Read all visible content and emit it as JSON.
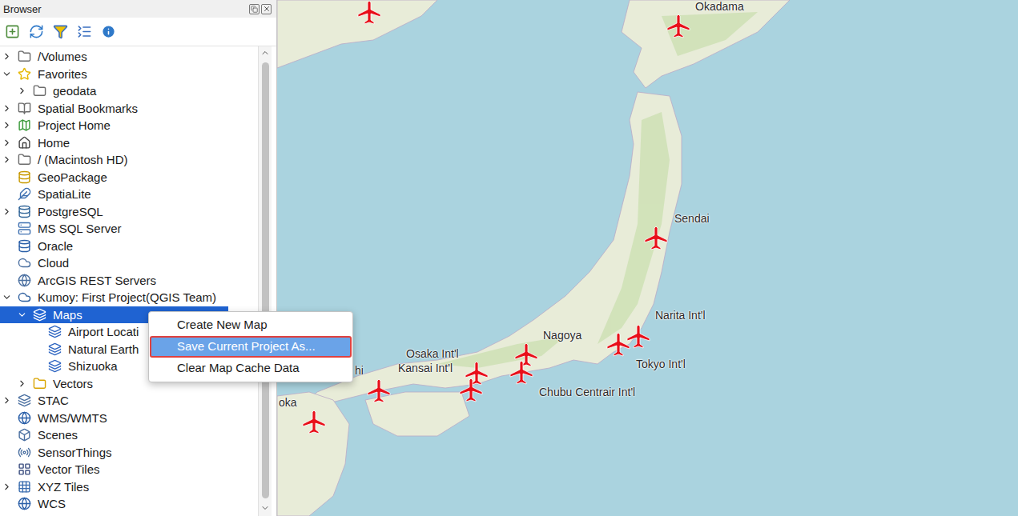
{
  "window": {
    "title": "Browser"
  },
  "tree": [
    {
      "label": "/Volumes",
      "depth": 0,
      "expandable": true,
      "expanded": false,
      "selected": false
    },
    {
      "label": "Favorites",
      "depth": 0,
      "expandable": true,
      "expanded": true,
      "selected": false
    },
    {
      "label": "geodata",
      "depth": 1,
      "expandable": true,
      "expanded": false,
      "selected": false
    },
    {
      "label": "Spatial Bookmarks",
      "depth": 0,
      "expandable": true,
      "expanded": false,
      "selected": false
    },
    {
      "label": "Project Home",
      "depth": 0,
      "expandable": true,
      "expanded": false,
      "selected": false
    },
    {
      "label": "Home",
      "depth": 0,
      "expandable": true,
      "expanded": false,
      "selected": false
    },
    {
      "label": "/ (Macintosh HD)",
      "depth": 0,
      "expandable": true,
      "expanded": false,
      "selected": false
    },
    {
      "label": "GeoPackage",
      "depth": 0,
      "expandable": false,
      "expanded": false,
      "selected": false
    },
    {
      "label": "SpatiaLite",
      "depth": 0,
      "expandable": false,
      "expanded": false,
      "selected": false
    },
    {
      "label": "PostgreSQL",
      "depth": 0,
      "expandable": true,
      "expanded": false,
      "selected": false
    },
    {
      "label": "MS SQL Server",
      "depth": 0,
      "expandable": false,
      "expanded": false,
      "selected": false
    },
    {
      "label": "Oracle",
      "depth": 0,
      "expandable": false,
      "expanded": false,
      "selected": false
    },
    {
      "label": "Cloud",
      "depth": 0,
      "expandable": false,
      "expanded": false,
      "selected": false
    },
    {
      "label": "ArcGIS REST Servers",
      "depth": 0,
      "expandable": false,
      "expanded": false,
      "selected": false
    },
    {
      "label": "Kumoy: First Project(QGIS Team)",
      "depth": 0,
      "expandable": true,
      "expanded": true,
      "selected": false
    },
    {
      "label": "Maps",
      "depth": 1,
      "expandable": true,
      "expanded": true,
      "selected": true
    },
    {
      "label": "Airport Locati",
      "depth": 2,
      "expandable": false,
      "expanded": false,
      "selected": false
    },
    {
      "label": "Natural Earth",
      "depth": 2,
      "expandable": false,
      "expanded": false,
      "selected": false
    },
    {
      "label": "Shizuoka",
      "depth": 2,
      "expandable": false,
      "expanded": false,
      "selected": false
    },
    {
      "label": "Vectors",
      "depth": 1,
      "expandable": true,
      "expanded": false,
      "selected": false
    },
    {
      "label": "STAC",
      "depth": 0,
      "expandable": true,
      "expanded": false,
      "selected": false
    },
    {
      "label": "WMS/WMTS",
      "depth": 0,
      "expandable": false,
      "expanded": false,
      "selected": false
    },
    {
      "label": "Scenes",
      "depth": 0,
      "expandable": false,
      "expanded": false,
      "selected": false
    },
    {
      "label": "SensorThings",
      "depth": 0,
      "expandable": false,
      "expanded": false,
      "selected": false
    },
    {
      "label": "Vector Tiles",
      "depth": 0,
      "expandable": false,
      "expanded": false,
      "selected": false
    },
    {
      "label": "XYZ Tiles",
      "depth": 0,
      "expandable": true,
      "expanded": false,
      "selected": false
    },
    {
      "label": "WCS",
      "depth": 0,
      "expandable": false,
      "expanded": false,
      "selected": false
    }
  ],
  "context_menu": [
    {
      "label": "Create New Map",
      "selected": false
    },
    {
      "label": "Save Current Project As...",
      "selected": true
    },
    {
      "label": "Clear Map Cache Data",
      "selected": false
    }
  ],
  "map": {
    "labels": [
      "Okadama",
      "Sendai",
      "Narita Int'l",
      "Nagoya",
      "Osaka Int'l",
      "Kansai Int'l",
      "Tokyo Int'l",
      "Chubu Centrair Int'l",
      "hi",
      "oka"
    ]
  }
}
